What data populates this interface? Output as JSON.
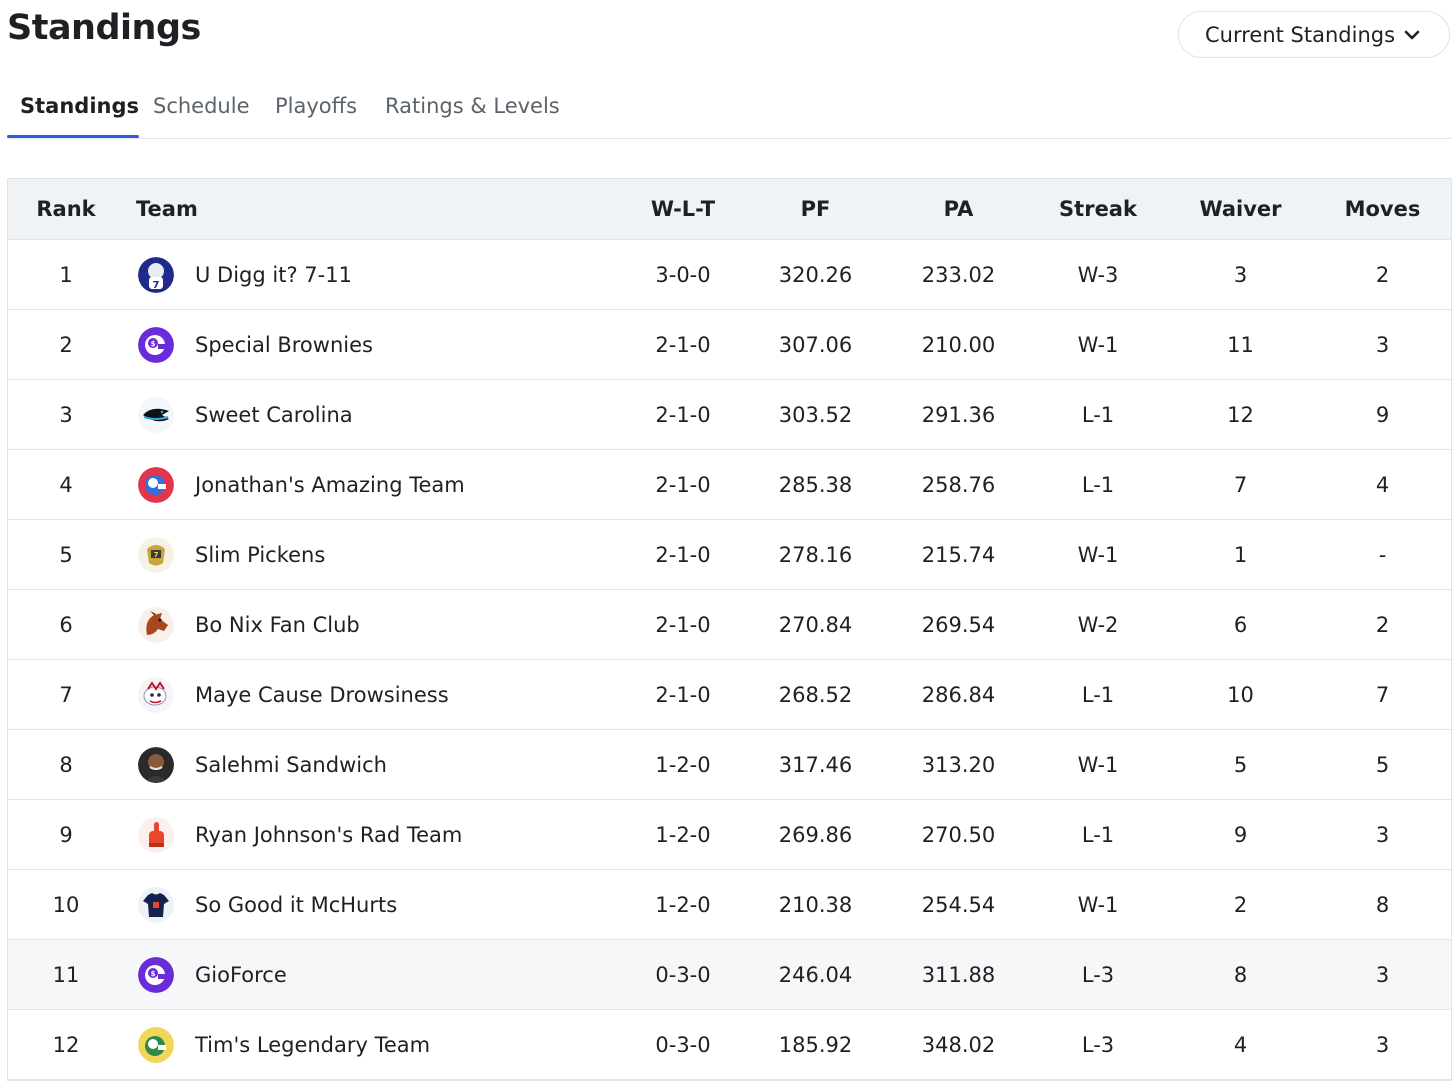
{
  "header": {
    "title": "Standings",
    "dropdown_label": "Current Standings"
  },
  "tabs": [
    {
      "label": "Standings",
      "active": true
    },
    {
      "label": "Schedule",
      "active": false
    },
    {
      "label": "Playoffs",
      "active": false
    },
    {
      "label": "Ratings & Levels",
      "active": false
    }
  ],
  "table": {
    "columns": [
      "Rank",
      "Team",
      "W-L-T",
      "PF",
      "PA",
      "Streak",
      "Waiver",
      "Moves"
    ],
    "rows": [
      {
        "rank": "1",
        "team": "U Digg it? 7-11",
        "icon": "player-helmet-icon",
        "wlt": "3-0-0",
        "pf": "320.26",
        "pa": "233.02",
        "streak": "W-3",
        "waiver": "3",
        "moves": "2"
      },
      {
        "rank": "2",
        "team": "Special Brownies",
        "icon": "purple-helmet-icon",
        "wlt": "2-1-0",
        "pf": "307.06",
        "pa": "210.00",
        "streak": "W-1",
        "waiver": "11",
        "moves": "3"
      },
      {
        "rank": "3",
        "team": "Sweet Carolina",
        "icon": "panther-icon",
        "wlt": "2-1-0",
        "pf": "303.52",
        "pa": "291.36",
        "streak": "L-1",
        "waiver": "12",
        "moves": "9"
      },
      {
        "rank": "4",
        "team": "Jonathan's Amazing Team",
        "icon": "red-helmet-icon",
        "wlt": "2-1-0",
        "pf": "285.38",
        "pa": "258.76",
        "streak": "L-1",
        "waiver": "7",
        "moves": "4"
      },
      {
        "rank": "5",
        "team": "Slim Pickens",
        "icon": "gold-helmet-icon",
        "wlt": "2-1-0",
        "pf": "278.16",
        "pa": "215.74",
        "streak": "W-1",
        "waiver": "1",
        "moves": "-"
      },
      {
        "rank": "6",
        "team": "Bo Nix Fan Club",
        "icon": "bronco-icon",
        "wlt": "2-1-0",
        "pf": "270.84",
        "pa": "269.54",
        "streak": "W-2",
        "waiver": "6",
        "moves": "2"
      },
      {
        "rank": "7",
        "team": "Maye Cause Drowsiness",
        "icon": "patriot-icon",
        "wlt": "2-1-0",
        "pf": "268.52",
        "pa": "286.84",
        "streak": "L-1",
        "waiver": "10",
        "moves": "7"
      },
      {
        "rank": "8",
        "team": "Salehmi Sandwich",
        "icon": "person-avatar-icon",
        "wlt": "1-2-0",
        "pf": "317.46",
        "pa": "313.20",
        "streak": "W-1",
        "waiver": "5",
        "moves": "5"
      },
      {
        "rank": "9",
        "team": "Ryan Johnson's Rad Team",
        "icon": "foam-finger-icon",
        "wlt": "1-2-0",
        "pf": "269.86",
        "pa": "270.50",
        "streak": "L-1",
        "waiver": "9",
        "moves": "3"
      },
      {
        "rank": "10",
        "team": "So Good it McHurts",
        "icon": "jersey-icon",
        "wlt": "1-2-0",
        "pf": "210.38",
        "pa": "254.54",
        "streak": "W-1",
        "waiver": "2",
        "moves": "8"
      },
      {
        "rank": "11",
        "team": "GioForce",
        "icon": "purple-helmet-icon",
        "wlt": "0-3-0",
        "pf": "246.04",
        "pa": "311.88",
        "streak": "L-3",
        "waiver": "8",
        "moves": "3",
        "highlight": true
      },
      {
        "rank": "12",
        "team": "Tim's Legendary Team",
        "icon": "green-helmet-icon",
        "wlt": "0-3-0",
        "pf": "185.92",
        "pa": "348.02",
        "streak": "L-3",
        "waiver": "4",
        "moves": "3"
      }
    ]
  },
  "colors": {
    "accent": "#2f5fe0",
    "header_bg": "#f0f3f5",
    "border": "#e0e4e9",
    "text": "#1f2023",
    "muted": "#5b636a"
  }
}
